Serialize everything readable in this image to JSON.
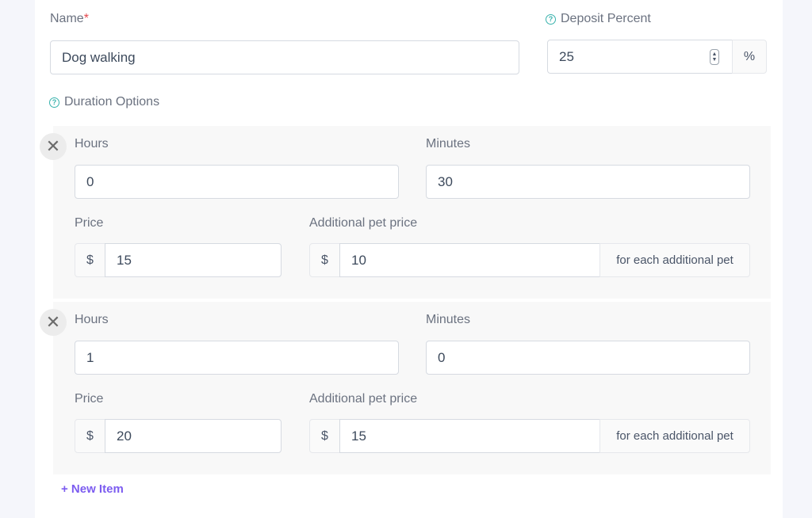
{
  "form": {
    "name_label": "Name",
    "name_required_mark": "*",
    "name_value": "Dog walking",
    "deposit_label": "Deposit Percent",
    "deposit_value": "25",
    "deposit_suffix": "%",
    "duration_label": "Duration Options",
    "help_glyph": "?",
    "new_item_label": "+ New Item"
  },
  "duration_options": [
    {
      "hours_label": "Hours",
      "hours_value": "0",
      "minutes_label": "Minutes",
      "minutes_value": "30",
      "price_label": "Price",
      "price_prefix": "$",
      "price_value": "15",
      "addl_label": "Additional pet price",
      "addl_prefix": "$",
      "addl_value": "10",
      "addl_suffix": "for each additional pet",
      "remove_glyph": "✕"
    },
    {
      "hours_label": "Hours",
      "hours_value": "1",
      "minutes_label": "Minutes",
      "minutes_value": "0",
      "price_label": "Price",
      "price_prefix": "$",
      "price_value": "20",
      "addl_label": "Additional pet price",
      "addl_prefix": "$",
      "addl_value": "15",
      "addl_suffix": "for each additional pet",
      "remove_glyph": "✕"
    }
  ],
  "icons": {
    "help": "question-circle-icon",
    "remove": "close-icon",
    "spinner": "number-spinner-icon"
  },
  "colors": {
    "accent_purple": "#7c5cf0",
    "help_teal": "#38b2ac",
    "required_red": "#e5484d"
  }
}
